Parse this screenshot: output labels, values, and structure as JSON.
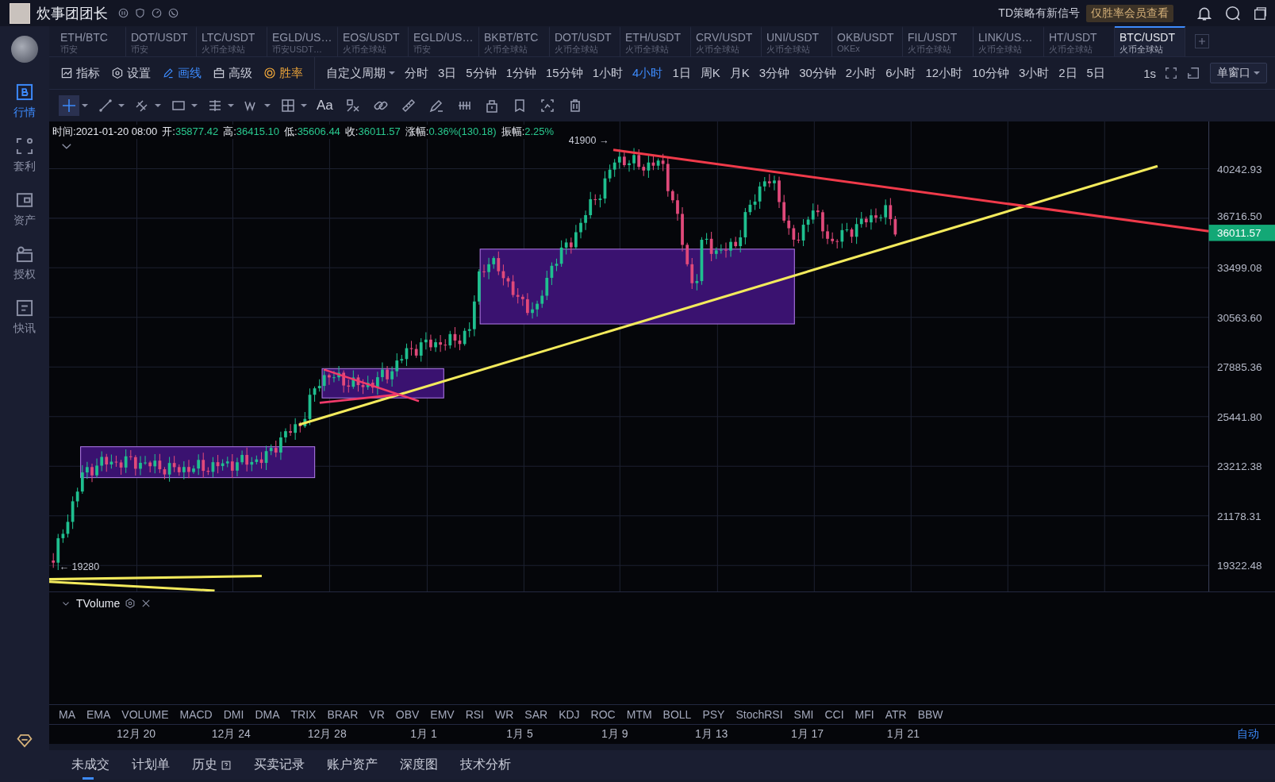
{
  "top_bar": {
    "user_name": "炊事团团长",
    "signal_text": "TD策略有新信号",
    "member_badge": "仅胜率会员查看"
  },
  "sidebar": {
    "items": [
      {
        "label": "行情",
        "kind": "market",
        "selected": true
      },
      {
        "label": "套利",
        "kind": "arbitrage",
        "selected": false
      },
      {
        "label": "资产",
        "kind": "assets",
        "selected": false
      },
      {
        "label": "授权",
        "kind": "auth",
        "selected": false
      },
      {
        "label": "快讯",
        "kind": "news",
        "selected": false
      }
    ]
  },
  "pair_tabs": [
    {
      "pair": "ETH/BTC",
      "exchange": "币安",
      "selected": false
    },
    {
      "pair": "DOT/USDT",
      "exchange": "币安",
      "selected": false
    },
    {
      "pair": "LTC/USDT",
      "exchange": "火币全球站",
      "selected": false
    },
    {
      "pair": "EGLD/US…",
      "exchange": "币安USDT…",
      "selected": false
    },
    {
      "pair": "EOS/USDT",
      "exchange": "火币全球站",
      "selected": false
    },
    {
      "pair": "EGLD/US…",
      "exchange": "币安",
      "selected": false
    },
    {
      "pair": "BKBT/BTC",
      "exchange": "火币全球站",
      "selected": false
    },
    {
      "pair": "DOT/USDT",
      "exchange": "火币全球站",
      "selected": false
    },
    {
      "pair": "ETH/USDT",
      "exchange": "火币全球站",
      "selected": false
    },
    {
      "pair": "CRV/USDT",
      "exchange": "火币全球站",
      "selected": false
    },
    {
      "pair": "UNI/USDT",
      "exchange": "火币全球站",
      "selected": false
    },
    {
      "pair": "OKB/USDT",
      "exchange": "OKEx",
      "selected": false
    },
    {
      "pair": "FIL/USDT",
      "exchange": "火币全球站",
      "selected": false
    },
    {
      "pair": "LINK/US…",
      "exchange": "火币全球站",
      "selected": false
    },
    {
      "pair": "HT/USDT",
      "exchange": "火币全球站",
      "selected": false
    },
    {
      "pair": "BTC/USDT",
      "exchange": "火币全球站",
      "selected": true
    }
  ],
  "chart_tools": [
    {
      "label": "指标",
      "kind": "indicator",
      "selected": false
    },
    {
      "label": "设置",
      "kind": "settings",
      "selected": false
    },
    {
      "label": "画线",
      "kind": "draw",
      "selected": true
    },
    {
      "label": "高级",
      "kind": "advanced",
      "selected": false
    },
    {
      "label": "胜率",
      "kind": "winrate",
      "selected": false
    }
  ],
  "custom_period": "自定义周期",
  "periods": [
    {
      "label": "分时",
      "selected": false
    },
    {
      "label": "3日",
      "selected": false
    },
    {
      "label": "5分钟",
      "selected": false
    },
    {
      "label": "1分钟",
      "selected": false
    },
    {
      "label": "15分钟",
      "selected": false
    },
    {
      "label": "1小时",
      "selected": false
    },
    {
      "label": "4小时",
      "selected": true
    },
    {
      "label": "1日",
      "selected": false
    },
    {
      "label": "周K",
      "selected": false
    },
    {
      "label": "月K",
      "selected": false
    },
    {
      "label": "3分钟",
      "selected": false
    },
    {
      "label": "30分钟",
      "selected": false
    },
    {
      "label": "2小时",
      "selected": false
    },
    {
      "label": "6小时",
      "selected": false
    },
    {
      "label": "12小时",
      "selected": false
    },
    {
      "label": "10分钟",
      "selected": false
    },
    {
      "label": "3小时",
      "selected": false
    },
    {
      "label": "2日",
      "selected": false
    },
    {
      "label": "5日",
      "selected": false
    }
  ],
  "refresh_interval": "1s",
  "window_mode": "单窗口",
  "drawing_tools": [
    {
      "kind": "crosshair",
      "selected": true,
      "has_menu": true
    },
    {
      "kind": "line",
      "selected": false,
      "has_menu": true
    },
    {
      "kind": "parallel",
      "selected": false,
      "has_menu": true
    },
    {
      "kind": "rectangle",
      "selected": false,
      "has_menu": true
    },
    {
      "kind": "hlines",
      "selected": false,
      "has_menu": true
    },
    {
      "kind": "wave",
      "selected": false,
      "has_menu": true
    },
    {
      "kind": "grid",
      "selected": false,
      "has_menu": true
    },
    {
      "kind": "text",
      "label": "Aa",
      "selected": false,
      "has_menu": false
    },
    {
      "kind": "pattern",
      "selected": false,
      "has_menu": false
    },
    {
      "kind": "link",
      "selected": false,
      "has_menu": false
    },
    {
      "kind": "ruler",
      "selected": false,
      "has_menu": false
    },
    {
      "kind": "pen",
      "selected": false,
      "has_menu": false
    },
    {
      "kind": "bars",
      "selected": false,
      "has_menu": false
    },
    {
      "kind": "lock",
      "selected": false,
      "has_menu": false
    },
    {
      "kind": "copy",
      "selected": false,
      "has_menu": false
    },
    {
      "kind": "frame",
      "selected": false,
      "has_menu": false
    },
    {
      "kind": "trash",
      "selected": false,
      "has_menu": false
    }
  ],
  "ohlc_info": [
    {
      "label": "时间:",
      "value": "2021-01-20 08:00",
      "kind": "time"
    },
    {
      "label": "开:",
      "value": "35877.42",
      "kind": "price"
    },
    {
      "label": "高:",
      "value": "36415.10",
      "kind": "price"
    },
    {
      "label": "低:",
      "value": "35606.44",
      "kind": "price"
    },
    {
      "label": "收:",
      "value": "36011.57",
      "kind": "price"
    },
    {
      "label": "涨幅:",
      "value": "0.36%(130.18)",
      "kind": "price"
    },
    {
      "label": "振幅:",
      "value": "2.25%",
      "kind": "price"
    }
  ],
  "chart": {
    "high_marker": "41900 →",
    "low_marker": "← 19280",
    "price_labels": [
      "40242.93",
      "36716.50",
      "33499.08",
      "30563.60",
      "27885.36",
      "25441.80",
      "23212.38",
      "21178.31",
      "19322.48"
    ],
    "last_price": "36011.57"
  },
  "volume_pane": {
    "title": "TVolume"
  },
  "indicators": [
    "MA",
    "EMA",
    "VOLUME",
    "MACD",
    "DMI",
    "DMA",
    "TRIX",
    "BRAR",
    "VR",
    "OBV",
    "EMV",
    "RSI",
    "WR",
    "SAR",
    "KDJ",
    "ROC",
    "MTM",
    "BOLL",
    "PSY",
    "StochRSI",
    "SMI",
    "CCI",
    "MFI",
    "ATR",
    "BBW"
  ],
  "date_labels": [
    "12月 20",
    "12月 24",
    "12月 28",
    "1月 1",
    "1月 5",
    "1月 9",
    "1月 13",
    "1月 17",
    "1月 21"
  ],
  "scale_mode": "自动",
  "bottom_tabs": [
    {
      "label": "未成交",
      "selected": true,
      "help": false
    },
    {
      "label": "计划单",
      "selected": false,
      "help": false
    },
    {
      "label": "历史",
      "selected": false,
      "help": true
    },
    {
      "label": "买卖记录",
      "selected": false,
      "help": false
    },
    {
      "label": "账户资产",
      "selected": false,
      "help": false
    },
    {
      "label": "深度图",
      "selected": false,
      "help": false
    },
    {
      "label": "技术分析",
      "selected": false,
      "help": false
    }
  ]
}
